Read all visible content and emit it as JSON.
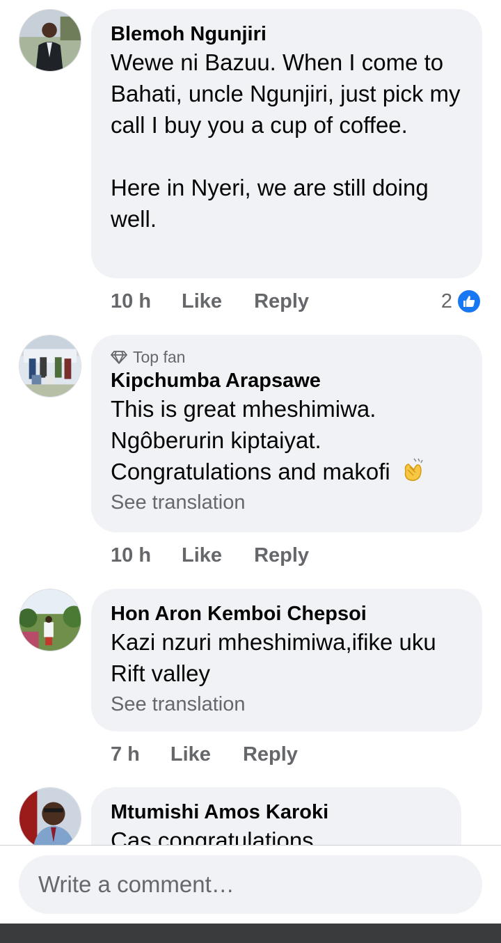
{
  "comments": [
    {
      "author": "Blemoh Ngunjiri",
      "text": "Wewe ni Bazuu. When I come to Bahati, uncle Ngunjiri, just pick my call I buy you a cup of coffee.\n\nHere in Nyeri, we are still doing well.",
      "time": "10 h",
      "like": "Like",
      "reply": "Reply",
      "reaction_count": "2"
    },
    {
      "badge": "Top fan",
      "author": "Kipchumba Arapsawe",
      "text": "This is great mheshimiwa.\nNgôberurin kiptaiyat.\nCongratulations and makofi",
      "see_translation": "See translation",
      "time": "10 h",
      "like": "Like",
      "reply": "Reply"
    },
    {
      "author": "Hon Aron Kemboi Chepsoi",
      "text": "Kazi nzuri mheshimiwa,ifike uku Rift valley",
      "see_translation": "See translation",
      "time": "7 h",
      "like": "Like",
      "reply": "Reply"
    },
    {
      "author": "Mtumishi Amos Karoki",
      "text": "Cas congratulations"
    }
  ],
  "composer": {
    "placeholder": "Write a comment…"
  },
  "colors": {
    "like_blue": "#1877f2",
    "bubble": "#f0f2f5",
    "muted": "#65676b"
  },
  "icons": [
    "diamond-icon",
    "like-thumb-icon",
    "clapping-hands-emoji"
  ]
}
